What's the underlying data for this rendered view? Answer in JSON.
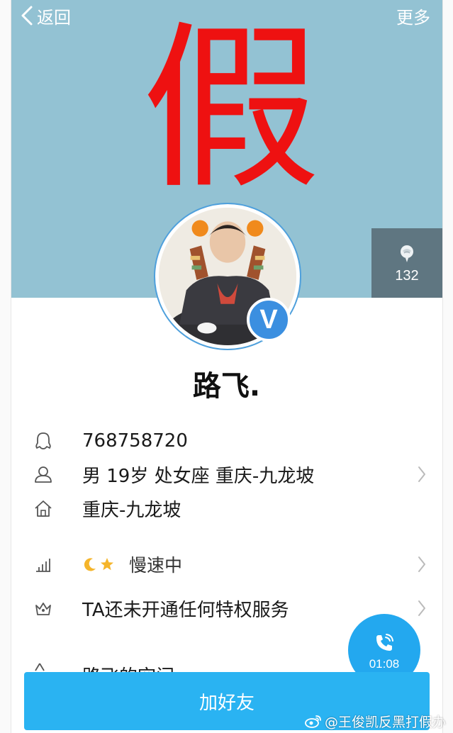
{
  "nav": {
    "back_label": "返回",
    "more_label": "更多"
  },
  "stamp_text": "假",
  "rose": {
    "count": "132",
    "icon": "rose-icon"
  },
  "profile": {
    "nickname": "路飞.",
    "verified_badge": "V"
  },
  "info_rows": [
    {
      "icon": "qq-penguin-icon",
      "text": "768758720",
      "has_chevron": false
    },
    {
      "icon": "person-icon",
      "text": "男 19岁 处女座 重庆-九龙坡",
      "has_chevron": true
    },
    {
      "icon": "home-icon",
      "text": "重庆-九龙坡",
      "has_chevron": false
    }
  ],
  "level_row": {
    "icon": "level-bars-icon",
    "badges": [
      "moon-icon",
      "star-icon"
    ],
    "text": "慢速中"
  },
  "vip_row": {
    "icon": "crown-icon",
    "text": "TA还未开通任何特权服务"
  },
  "partial_row": {
    "text": "路飞的空间"
  },
  "call": {
    "time": "01:08",
    "icon": "phone-icon"
  },
  "add_friend_label": "加好友",
  "watermark": "@王俊凯反黑打假办",
  "colors": {
    "banner": "#93c2d3",
    "stamp": "#ee1111",
    "accent": "#2ab3f2",
    "rose_box": "#5f7681"
  }
}
